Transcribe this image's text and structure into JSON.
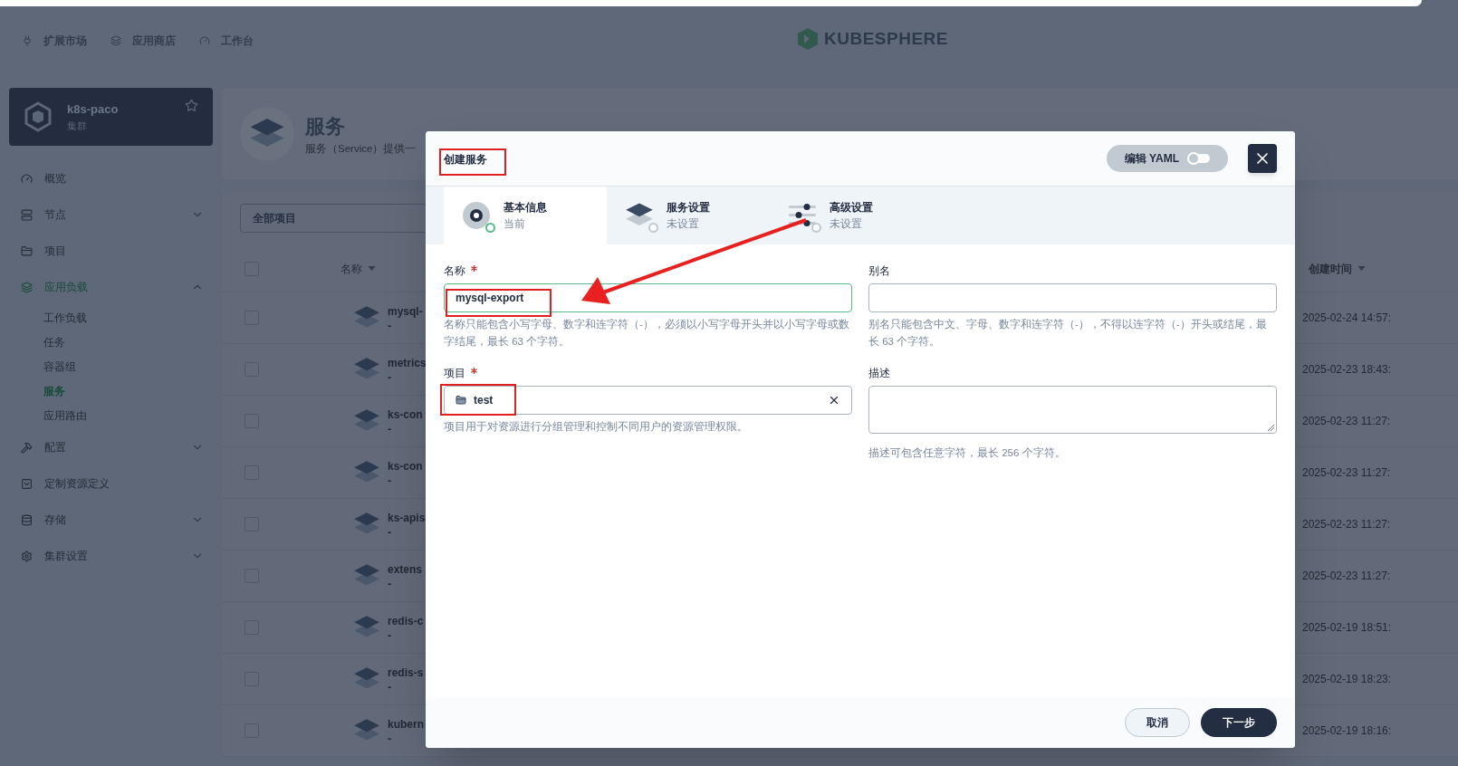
{
  "top_nav": [
    {
      "label": "扩展市场"
    },
    {
      "label": "应用商店"
    },
    {
      "label": "工作台"
    }
  ],
  "logo": {
    "text": "KUBESPHERE"
  },
  "cluster": {
    "name": "k8s-paco",
    "type": "集群",
    "starred": false
  },
  "sidebar": {
    "items": [
      {
        "label": "概览",
        "selected": false
      },
      {
        "label": "节点",
        "selected": false,
        "expanded": false
      },
      {
        "label": "项目",
        "selected": false
      },
      {
        "label": "应用负载",
        "selected": true,
        "expanded": true,
        "children": [
          {
            "label": "工作负载",
            "selected": false
          },
          {
            "label": "任务",
            "selected": false
          },
          {
            "label": "容器组",
            "selected": false
          },
          {
            "label": "服务",
            "selected": true
          },
          {
            "label": "应用路由",
            "selected": false
          }
        ]
      },
      {
        "label": "配置",
        "selected": false,
        "expanded": false
      },
      {
        "label": "定制资源定义",
        "selected": false
      },
      {
        "label": "存储",
        "selected": false,
        "expanded": false
      },
      {
        "label": "集群设置",
        "selected": false,
        "expanded": false
      }
    ]
  },
  "page_header": {
    "title": "服务",
    "description": "服务（Service）提供一"
  },
  "filter": {
    "value": "全部项目"
  },
  "table": {
    "all_checked": false,
    "columns": [
      "名称",
      "创建时间"
    ],
    "rows": [
      {
        "name": "mysql-",
        "subtitle": "-",
        "created": "2025-02-24 14:57:",
        "checked": false
      },
      {
        "name": "metrics",
        "subtitle": "-",
        "created": "2025-02-23 18:43:",
        "checked": false
      },
      {
        "name": "ks-con",
        "subtitle": "-",
        "created": "2025-02-23 11:27:",
        "checked": false
      },
      {
        "name": "ks-con",
        "subtitle": "-",
        "created": "2025-02-23 11:27:",
        "checked": false
      },
      {
        "name": "ks-apis",
        "subtitle": "-",
        "created": "2025-02-23 11:27:",
        "checked": false
      },
      {
        "name": "extens",
        "subtitle": "-",
        "created": "2025-02-23 11:27:",
        "checked": false
      },
      {
        "name": "redis-c",
        "subtitle": "-",
        "created": "2025-02-19 18:51:",
        "checked": false
      },
      {
        "name": "redis-s",
        "subtitle": "-",
        "created": "2025-02-19 18:23:",
        "checked": false
      },
      {
        "name": "kubern",
        "subtitle": "-",
        "created": "2025-02-19 18:16:",
        "checked": false
      }
    ]
  },
  "modal": {
    "title": "创建服务",
    "yaml_toggle": {
      "label": "编辑 YAML",
      "on": false
    },
    "steps": [
      {
        "title": "基本信息",
        "status": "当前",
        "selected": true
      },
      {
        "title": "服务设置",
        "status": "未设置",
        "selected": false
      },
      {
        "title": "高级设置",
        "status": "未设置",
        "selected": false
      }
    ],
    "fields": [
      {
        "kind": "text",
        "label": "名称",
        "required": true,
        "value": "mysql-export",
        "focused": true,
        "hint": "名称只能包含小写字母、数字和连字符（-），必须以小写字母开头并以小写字母或数字结尾，最长 63 个字符。"
      },
      {
        "kind": "text",
        "label": "别名",
        "required": false,
        "focused": false,
        "hint": "别名只能包含中文、字母、数字和连字符（-），不得以连字符（-）开头或结尾，最长 63 个字符。"
      },
      {
        "kind": "select",
        "label": "项目",
        "required": true,
        "value": "test",
        "hint": "项目用于对资源进行分组管理和控制不同用户的资源管理权限。"
      },
      {
        "kind": "textarea",
        "label": "描述",
        "required": false,
        "hint": "描述可包含任意字符，最长 256 个字符。"
      }
    ],
    "buttons": [
      {
        "label": "取消",
        "kind": "secondary"
      },
      {
        "label": "下一步",
        "kind": "primary"
      }
    ]
  }
}
